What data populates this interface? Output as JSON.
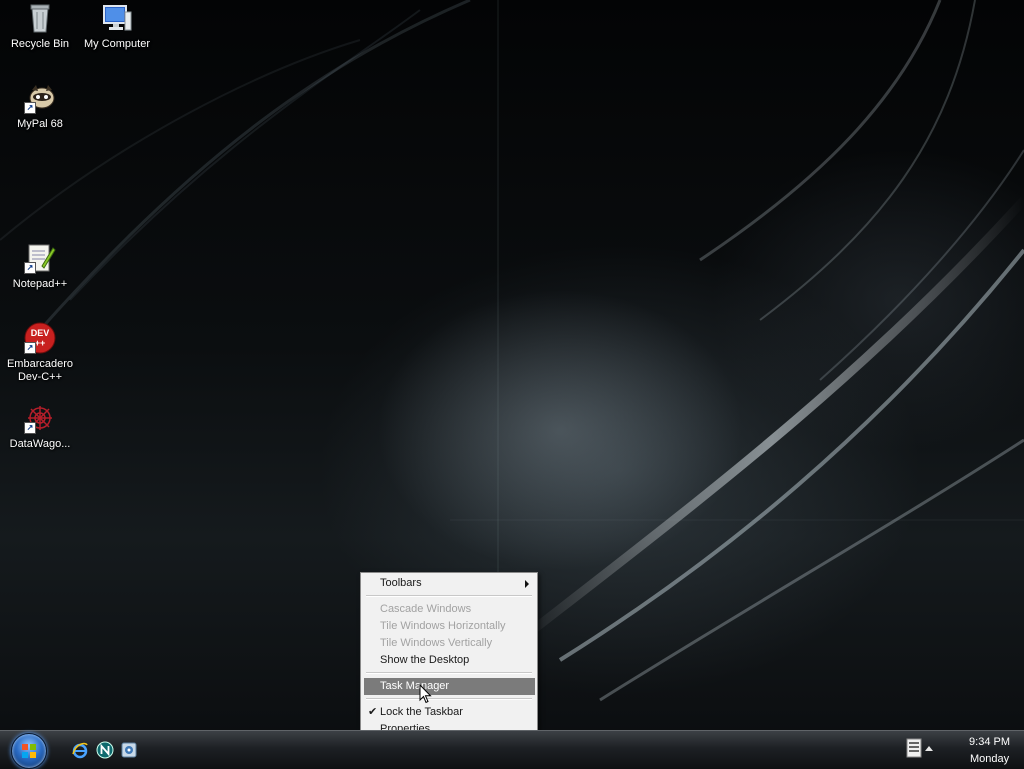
{
  "desktop": {
    "icons": [
      {
        "label": "Recycle Bin",
        "icon": "recycle-bin-icon"
      },
      {
        "label": "My Computer",
        "icon": "computer-icon"
      },
      {
        "label": "MyPal 68",
        "icon": "mypal-icon"
      },
      {
        "label": "Notepad++",
        "icon": "notepad-plus-plus-icon"
      },
      {
        "label": "Embarcadero Dev-C++",
        "icon": "dev-cpp-icon",
        "badge": "DEV++"
      },
      {
        "label": "DataWago...",
        "icon": "datawagon-icon"
      }
    ]
  },
  "context_menu": {
    "items": [
      {
        "label": "Toolbars",
        "state": "enabled",
        "submenu": true
      },
      {
        "label": "Cascade Windows",
        "state": "disabled"
      },
      {
        "label": "Tile Windows Horizontally",
        "state": "disabled"
      },
      {
        "label": "Tile Windows Vertically",
        "state": "disabled"
      },
      {
        "label": "Show the Desktop",
        "state": "enabled"
      },
      {
        "label": "Task Manager",
        "state": "highlighted"
      },
      {
        "label": "Lock the Taskbar",
        "state": "checked"
      },
      {
        "label": "Properties",
        "state": "enabled"
      }
    ],
    "check_mark": "✔"
  },
  "taskbar": {
    "start_button": "start-orb-icon",
    "quick_launch": [
      "internet-explorer-icon",
      "netscape-icon",
      "media-icon"
    ],
    "tray_icons": [
      "keyboard-icon",
      "expand-arrow-icon"
    ],
    "clock": {
      "time": "9:34 PM",
      "day": "Monday"
    }
  },
  "colors": {
    "menu_highlight": "#7b7b7b",
    "menu_background": "#f1f1f1",
    "disabled_text": "#a2a2a2"
  }
}
